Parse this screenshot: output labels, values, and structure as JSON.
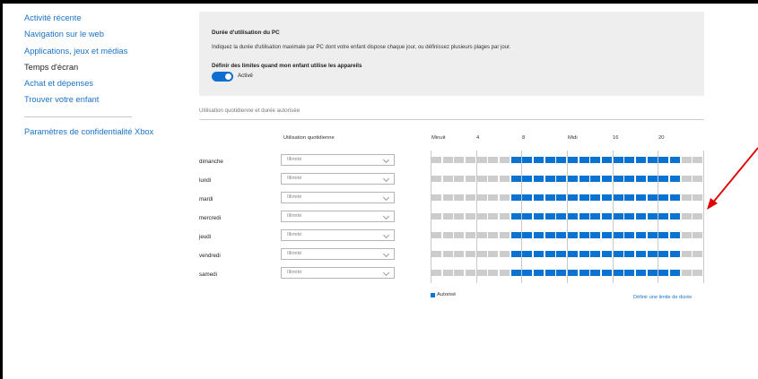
{
  "sidebar": {
    "items": [
      {
        "label": "Activité récente",
        "selected": false
      },
      {
        "label": "Navigation sur le web",
        "selected": false
      },
      {
        "label": "Applications, jeux et médias",
        "selected": false
      },
      {
        "label": "Temps d'écran",
        "selected": true
      },
      {
        "label": "Achat et dépenses",
        "selected": false
      },
      {
        "label": "Trouver votre enfant",
        "selected": false
      }
    ],
    "xbox_link": "Paramètres de confidentialité Xbox"
  },
  "panel": {
    "title": "Durée d'utilisation du PC",
    "description": "Indiquez la durée d'utilisation maximale par PC dont votre enfant dispose chaque jour, ou définissez plusieurs plages par jour.",
    "limit_label": "Définir des limites quand mon enfant utilise les appareils",
    "toggle_label": "Activé",
    "toggle_on": true
  },
  "schedule": {
    "section_title": "Utilisation quotidienne et durée autorisée",
    "usage_header": "Utilisation quotidienne",
    "time_labels": [
      "Minuit",
      "4",
      "8",
      "Midi",
      "16",
      "20"
    ],
    "days": [
      {
        "name": "dimanche",
        "usage": "Illimité"
      },
      {
        "name": "lundi",
        "usage": "Illimité"
      },
      {
        "name": "mardi",
        "usage": "Illimité"
      },
      {
        "name": "mercredi",
        "usage": "Illimité"
      },
      {
        "name": "jeudi",
        "usage": "Illimité"
      },
      {
        "name": "vendredi",
        "usage": "Illimité"
      },
      {
        "name": "samedi",
        "usage": "Illimité"
      }
    ],
    "allowed_start_hour": 7,
    "allowed_end_hour": 22,
    "legend_label": "Autorisé",
    "define_limit_link": "Définir une limite de durée",
    "colors": {
      "allowed": "#0a73d1",
      "blocked": "#cccccc"
    }
  }
}
